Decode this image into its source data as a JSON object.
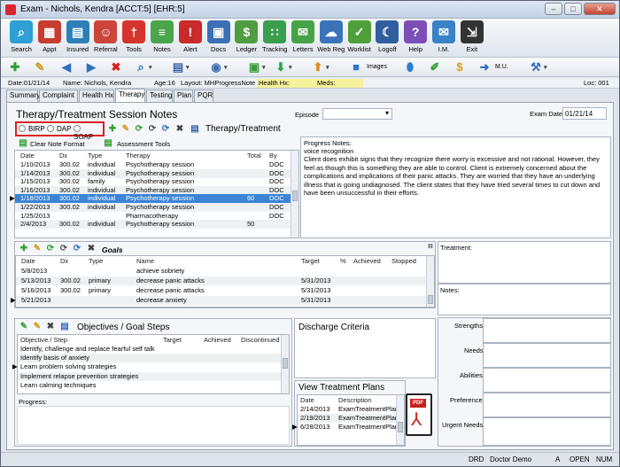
{
  "window": {
    "title": "Exam - Nichols, Kendra [ACCT:5] [EHR:5]"
  },
  "ribbon": [
    {
      "label": "Search",
      "icon": "search-icon",
      "color": "#2d9fd5",
      "glyph": "⌕"
    },
    {
      "label": "Appt",
      "icon": "calendar-icon",
      "color": "#c63d2f",
      "glyph": "▦"
    },
    {
      "label": "Insured",
      "icon": "insurance-card-icon",
      "color": "#2e7fb8",
      "glyph": "▤"
    },
    {
      "label": "Referral",
      "icon": "referral-icon",
      "color": "#cb4539",
      "glyph": "☺"
    },
    {
      "label": "Tools",
      "icon": "pin-icon",
      "color": "#d5342c",
      "glyph": "†"
    },
    {
      "label": "Notes",
      "icon": "notes-icon",
      "color": "#4aa54a",
      "glyph": "≡"
    },
    {
      "label": "Alert",
      "icon": "alert-icon",
      "color": "#c92a2a",
      "glyph": "!"
    },
    {
      "label": "Docs",
      "icon": "docs-icon",
      "color": "#3b6fb6",
      "glyph": "▣"
    },
    {
      "label": "Ledger",
      "icon": "ledger-icon",
      "color": "#4e9d41",
      "glyph": "$"
    },
    {
      "label": "Tracking",
      "icon": "footprints-icon",
      "color": "#3a9e4c",
      "glyph": "∷"
    },
    {
      "label": "Letters",
      "icon": "paperclip-icon",
      "color": "#46a347",
      "glyph": "✉"
    },
    {
      "label": "Web Reg",
      "icon": "cloud-icon",
      "color": "#3a73b8",
      "glyph": "☁"
    },
    {
      "label": "Worklist",
      "icon": "clipboard-icon",
      "color": "#4f9f3b",
      "glyph": "✓"
    },
    {
      "label": "Logoff",
      "icon": "moon-icon",
      "color": "#2f5f9f",
      "glyph": "☾"
    },
    {
      "label": "Help",
      "icon": "help-icon",
      "color": "#7b4fb5",
      "glyph": "?"
    },
    {
      "label": "I.M.",
      "icon": "instant-message-icon",
      "color": "#3a82c7",
      "glyph": "✉"
    },
    {
      "label": "Exit",
      "icon": "exit-icon",
      "color": "#333333",
      "glyph": "⇲"
    }
  ],
  "toolbar": {
    "images_label": "Images",
    "mu_label": "M.U."
  },
  "info": {
    "date": "Date:01/21/14",
    "name": "Name: Nichols, Kendra",
    "age": "Age:16",
    "layout": "Layout: MHProgressNote",
    "health_hx": "Health Hx:",
    "meds": "Meds:",
    "loc": "Loc: 001"
  },
  "tabs": [
    "Summary",
    "Complaint",
    "Health Hx",
    "Therapy",
    "Testing",
    "Plan",
    "PQR"
  ],
  "therapy": {
    "title": "Therapy/Treatment Session Notes",
    "episode_label": "Episode",
    "exam_date_label": "Exam Date",
    "exam_date": "01/21/14",
    "formats": [
      "BIRP",
      "DAP",
      "SOAP"
    ],
    "section": "Therapy/Treatment",
    "clear_label": "Clear Note Format",
    "assess_label": "Assessment Tools",
    "cols": [
      "Date",
      "Dx",
      "Type",
      "Therapy",
      "Total",
      "By"
    ],
    "rows": [
      [
        "1/10/2013",
        "300.02",
        "individual",
        "Psychotherapy session",
        "",
        "DOC"
      ],
      [
        "1/14/2013",
        "300.02",
        "individual",
        "Psychotherapy session",
        "",
        "DOC"
      ],
      [
        "1/15/2013",
        "300.02",
        "family",
        "Psychotherapy session",
        "",
        "DOC"
      ],
      [
        "1/16/2013",
        "300.02",
        "individual",
        "Psychotherapy session",
        "",
        "DOC"
      ],
      [
        "1/18/2013",
        "300.02",
        "individual",
        "Psychotherapy session",
        "60",
        "DOC"
      ],
      [
        "1/22/2013",
        "300.02",
        "individual",
        "Psychotherapy session",
        "",
        "DOC"
      ],
      [
        "1/25/2013",
        "",
        "",
        "Pharmacotherapy",
        "",
        "DOC"
      ],
      [
        "2/4/2013",
        "300.02",
        "individual",
        "Psychotherapy session",
        "50",
        ""
      ]
    ],
    "selected_row": 4,
    "progress_label": "Progress Notes:",
    "progress_line1": "voice recognition",
    "progress_text": "Client does exhibit signs that they recognize there worry is excessive and not rational.  However, they feel as though this is something they are able to control. Client is extremely concerned about the complications and implications of their panic attacks.  They are worried that they have an underlying illness that is going undiagnosed. The client states that they have tried several times to cut down and have been unsuccessful in their efforts."
  },
  "goals": {
    "title": "Goals",
    "cols": [
      "Date",
      "Dx",
      "Type",
      "Name",
      "Target",
      "%",
      "Achieved",
      "Stopped"
    ],
    "rows": [
      [
        "5/8/2013",
        "",
        "",
        "achieve sobriety",
        "",
        "",
        "",
        ""
      ],
      [
        "5/13/2013",
        "300.02",
        "primary",
        "decrease panic attacks",
        "5/31/2013",
        "",
        "",
        ""
      ],
      [
        "5/16/2013",
        "300.02",
        "primary",
        "decrease panic attacks",
        "5/31/2013",
        "",
        "",
        ""
      ],
      [
        "5/21/2013",
        "",
        "",
        "decrease anxiety",
        "5/31/2013",
        "",
        "",
        ""
      ]
    ],
    "treatment_label": "Treatment:",
    "notes_label": "Notes:"
  },
  "objectives": {
    "title": "Objectives / Goal Steps",
    "cols": [
      "Objective / Step",
      "Target",
      "Achieved",
      "Discontinued"
    ],
    "rows": [
      "Identify, challenge and replace fearful self talk",
      "Identify basis of anxiety",
      "Learn problem solving strategies",
      "Implement relapse prevention strategies",
      "Learn calming techniques"
    ],
    "progress_label": "Progress:"
  },
  "discharge": {
    "title": "Discharge Criteria"
  },
  "plans": {
    "title": "View Treatment Plans",
    "cols": [
      "Date",
      "Description"
    ],
    "rows": [
      [
        "2/14/2013",
        "ExamTreatmentPlan"
      ],
      [
        "2/19/2013",
        "ExamTreatmentPlan"
      ],
      [
        "6/28/2013",
        "ExamTreatmentPlan"
      ]
    ]
  },
  "side": {
    "strengths": "Strengths",
    "needs": "Needs",
    "abilities": "Abilities",
    "preference": "Preference",
    "urgent_needs": "Urgent Needs"
  },
  "status": {
    "drd": "DRD",
    "doctor": "Doctor Demo",
    "a": "A",
    "open": "OPEN",
    "num": "NUM"
  }
}
